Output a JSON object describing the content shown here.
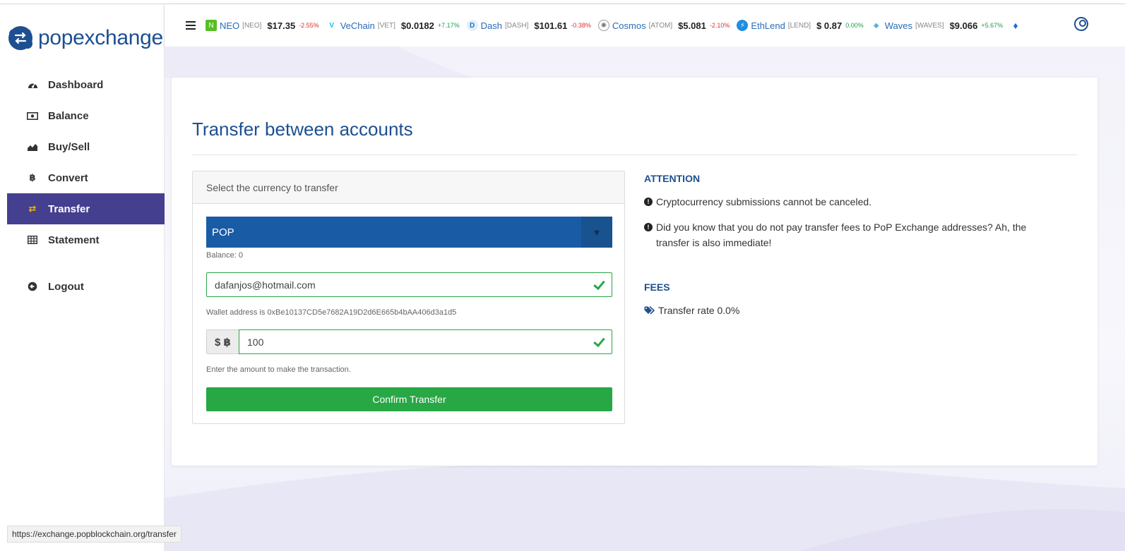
{
  "brand": {
    "name": "popexchange"
  },
  "sidebar": {
    "items": [
      {
        "label": "Dashboard",
        "icon": "tachometer-icon"
      },
      {
        "label": "Balance",
        "icon": "money-bill-icon"
      },
      {
        "label": "Buy/Sell",
        "icon": "chart-area-icon"
      },
      {
        "label": "Convert",
        "icon": "bitcoin-icon"
      },
      {
        "label": "Transfer",
        "icon": "exchange-arrows-icon",
        "active": true
      },
      {
        "label": "Statement",
        "icon": "table-icon"
      }
    ],
    "logout": {
      "label": "Logout",
      "icon": "arrow-circle-left-icon"
    }
  },
  "ticker": [
    {
      "name": "NEO",
      "symbol": "[NEO]",
      "price": "$17.35",
      "change": "-2.55%",
      "trend": "down",
      "color": "#58be23"
    },
    {
      "name": "VeChain",
      "symbol": "[VET]",
      "price": "$0.0182",
      "change": "+7.17%",
      "trend": "up",
      "color": "#15bdff"
    },
    {
      "name": "Dash",
      "symbol": "[DASH]",
      "price": "$101.61",
      "change": "-0.38%",
      "trend": "down",
      "color": "#1c75bc"
    },
    {
      "name": "Cosmos",
      "symbol": "[ATOM]",
      "price": "$5.081",
      "change": "-2.10%",
      "trend": "down",
      "color": "#9a9a9a"
    },
    {
      "name": "EthLend",
      "symbol": "[LEND]",
      "price": "$ 0.87",
      "change": "0.00%",
      "trend": "flat",
      "color": "#1f8de0"
    },
    {
      "name": "Waves",
      "symbol": "[WAVES]",
      "price": "$9.066",
      "change": "+5.67%",
      "trend": "up",
      "color": "#55b0e8"
    }
  ],
  "main": {
    "title": "Transfer between accounts",
    "panel_header": "Select the currency to transfer",
    "currency": {
      "selected": "POP"
    },
    "balance_text": "Balance: 0",
    "recipient": {
      "value": "dafanjos@hotmail.com"
    },
    "wallet_text": "Wallet address is 0xBe10137CD5e7682A19D2d6E665b4bAA406d3a1d5",
    "amount": {
      "prefix": "$ ฿",
      "value": "100"
    },
    "amount_help": "Enter the amount to make the transaction.",
    "confirm_label": "Confirm Transfer"
  },
  "attention": {
    "title": "ATTENTION",
    "lines": [
      "Cryptocurrency submissions cannot be canceled.",
      "Did you know that you do not pay transfer fees to PoP Exchange addresses? Ah, the transfer is also immediate!"
    ]
  },
  "fees": {
    "title": "FEES",
    "rate": "Transfer rate 0.0%"
  },
  "status_bar": {
    "url": "https://exchange.popblockchain.org/transfer"
  },
  "colors": {
    "brand_blue": "#1d4f91",
    "active_nav": "#453f8f",
    "select_bg": "#1a5ba6",
    "success": "#28a745",
    "negative": "#e03030",
    "positive": "#18a34a"
  }
}
